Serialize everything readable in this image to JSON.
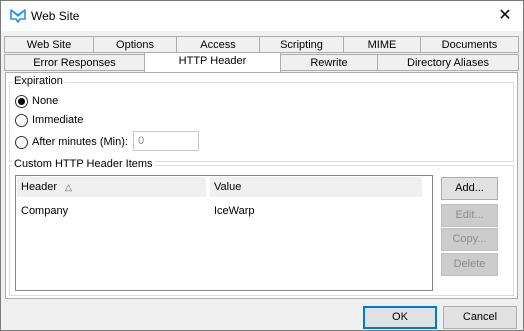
{
  "window": {
    "title": "Web Site",
    "close_glyph": "✕"
  },
  "icons": {
    "app_icon": "icewarp-webserver-icon",
    "close_icon": "close-icon",
    "sort_icon": "sort-ascending-icon"
  },
  "colors": {
    "accent": "#0078d7",
    "icon_blue": "#1e90ff"
  },
  "tabs": {
    "row1": [
      "Web Site",
      "Options",
      "Access",
      "Scripting",
      "MIME",
      "Documents"
    ],
    "row2": [
      "Error Responses",
      "HTTP Header",
      "Rewrite",
      "Directory Aliases"
    ],
    "active": "HTTP Header"
  },
  "expiration": {
    "legend": "Expiration",
    "options": [
      "None",
      "Immediate",
      "After minutes (Min):"
    ],
    "selected": "None",
    "minutes_value": "0"
  },
  "custom_headers": {
    "legend": "Custom HTTP Header Items",
    "columns": [
      "Header",
      "Value"
    ],
    "sort_glyph": "△",
    "rows": [
      {
        "header": "Company",
        "value": "IceWarp"
      }
    ]
  },
  "side_buttons": {
    "add": "Add...",
    "edit": "Edit...",
    "copy": "Copy...",
    "delete": "Delete"
  },
  "dialog_buttons": {
    "ok": "OK",
    "cancel": "Cancel"
  }
}
